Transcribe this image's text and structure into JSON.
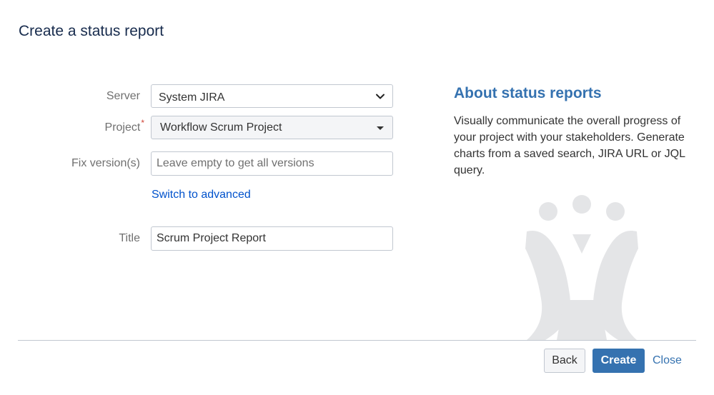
{
  "dialog": {
    "title": "Create a status report"
  },
  "form": {
    "server": {
      "label": "Server",
      "value": "System JIRA"
    },
    "project": {
      "label": "Project",
      "required_marker": "*",
      "value": "Workflow Scrum Project"
    },
    "fix_versions": {
      "label": "Fix version(s)",
      "value": "",
      "placeholder": "Leave empty to get all versions"
    },
    "switch_link": "Switch to advanced",
    "title_field": {
      "label": "Title",
      "value": "Scrum Project Report"
    }
  },
  "about": {
    "heading": "About status reports",
    "text": "Visually communicate the overall progress of your project with your stakeholders. Generate charts from a saved search, JIRA URL or JQL query."
  },
  "footer": {
    "back_label": "Back",
    "create_label": "Create",
    "close_label": "Close"
  },
  "colors": {
    "primary": "#3572b0",
    "link": "#0052cc",
    "required": "#d04437",
    "logo_watermark": "#e4e5e7"
  },
  "icons": {
    "server_dropdown": "chevron-down-icon",
    "project_dropdown": "caret-down-icon",
    "watermark": "jira-logo-icon"
  }
}
